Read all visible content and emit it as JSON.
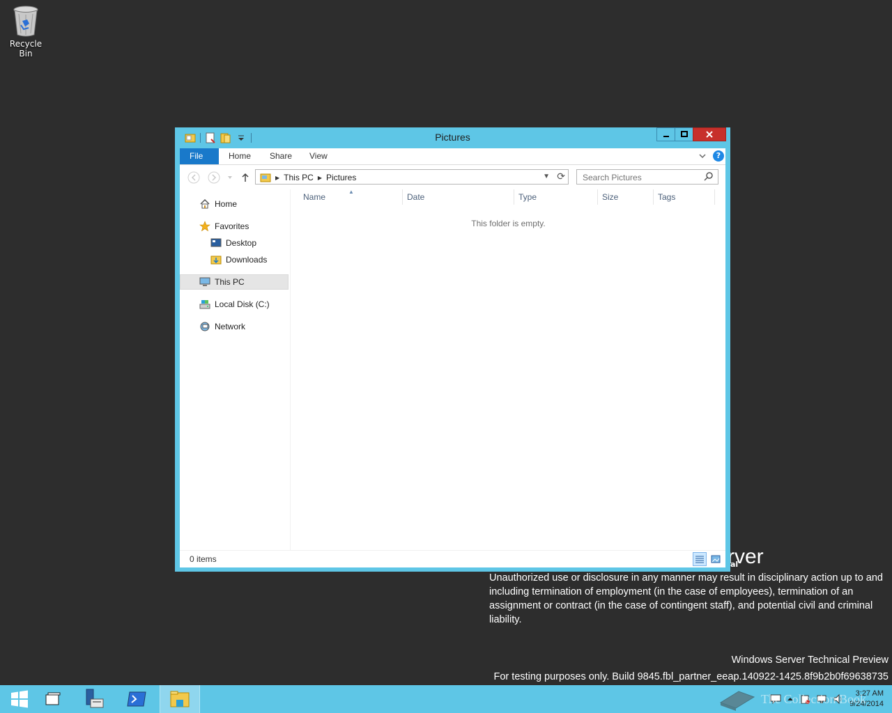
{
  "desktop": {
    "recycle_bin_label": "Recycle Bin"
  },
  "watermark": {
    "big_fragment": "rver",
    "small_fragment": "al",
    "notice": "Unauthorized use or disclosure in any manner may result in disciplinary action up to and including termination of employment (in the case of employees), termination of an assignment or contract (in the case of contingent staff), and potential civil and criminal liability.",
    "edition": "Windows Server Technical Preview",
    "build": "For testing purposes only. Build 9845.fbl_partner_eeap.140922-1425.8f9b2b0f69638735",
    "brand": "The Collection Book"
  },
  "window": {
    "title": "Pictures",
    "ribbon_tabs": [
      "File",
      "Home",
      "Share",
      "View"
    ],
    "address": {
      "crumbs": [
        "This PC",
        "Pictures"
      ]
    },
    "search": {
      "placeholder": "Search Pictures"
    },
    "nav": {
      "items": [
        {
          "label": "Home",
          "icon": "home-icon"
        },
        {
          "label": "Favorites",
          "icon": "star-icon"
        },
        {
          "label": "Desktop",
          "icon": "desktop-icon"
        },
        {
          "label": "Downloads",
          "icon": "downloads-folder-icon"
        },
        {
          "label": "This PC",
          "icon": "computer-icon",
          "selected": true
        },
        {
          "label": "Local Disk (C:)",
          "icon": "drive-icon"
        },
        {
          "label": "Network",
          "icon": "network-icon"
        }
      ]
    },
    "columns": [
      "Name",
      "Date",
      "Type",
      "Size",
      "Tags"
    ],
    "empty_message": "This folder is empty.",
    "status": "0 items"
  },
  "taskbar": {
    "time": "3:27 AM",
    "date": "9/24/2014"
  },
  "colors": {
    "window_frame": "#5ec6e6",
    "file_tab": "#1979ca",
    "close_button": "#c7302b",
    "desktop": "#2d2d2d"
  }
}
